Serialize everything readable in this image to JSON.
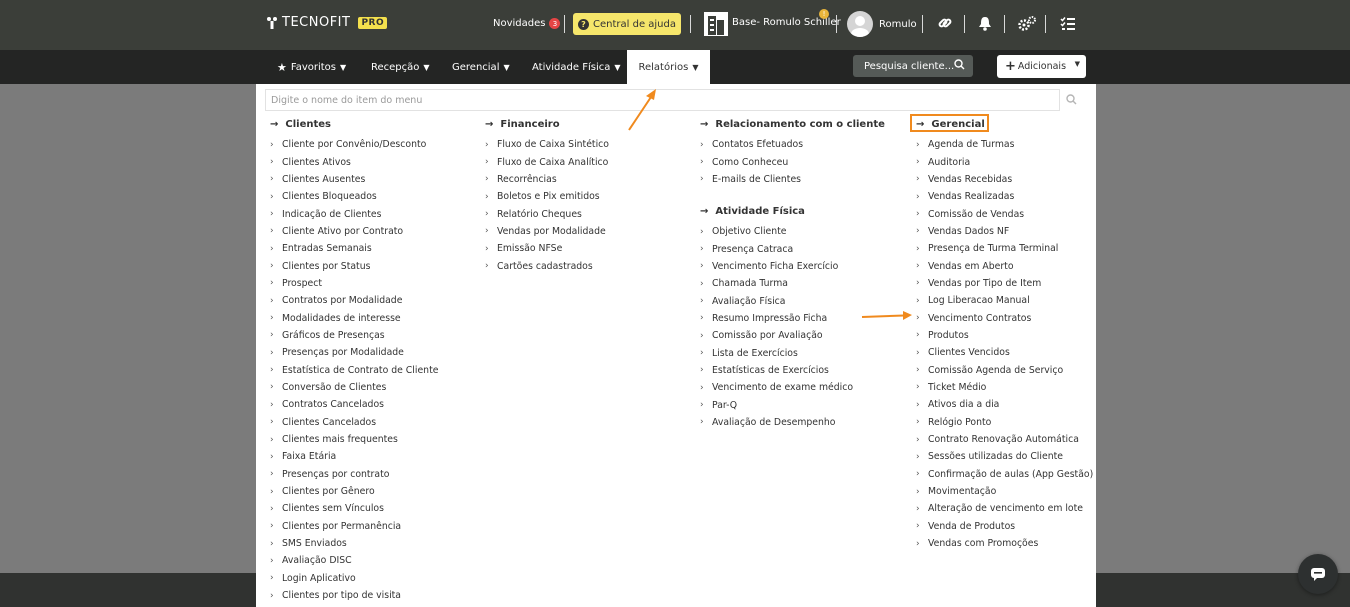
{
  "topbar": {
    "brand": "TECNOFIT",
    "brand_badge": "PRO",
    "novidades_label": "Novidades",
    "novidades_count": "3",
    "help_label": "Central de ajuda",
    "base_label": "Base- Romulo Schiller",
    "base_badge": "!",
    "user_name": "Romulo"
  },
  "navbar": {
    "items": [
      {
        "label": "Favoritos"
      },
      {
        "label": "Recepção"
      },
      {
        "label": "Gerencial"
      },
      {
        "label": "Atividade Física"
      },
      {
        "label": "Relatórios"
      }
    ],
    "search_placeholder": "Pesquisa cliente...",
    "add_label": "Adicionais"
  },
  "menu": {
    "search_placeholder": "Digite o nome do item do menu",
    "clientes": {
      "title": "Clientes",
      "items": [
        "Cliente por Convênio/Desconto",
        "Clientes Ativos",
        "Clientes Ausentes",
        "Clientes Bloqueados",
        "Indicação de Clientes",
        "Cliente Ativo por Contrato",
        "Entradas Semanais",
        "Clientes por Status",
        "Prospect",
        "Contratos por Modalidade",
        "Modalidades de interesse",
        "Gráficos de Presenças",
        "Presenças por Modalidade",
        "Estatística de Contrato de Cliente",
        "Conversão de Clientes",
        "Contratos Cancelados",
        "Clientes Cancelados",
        "Clientes mais frequentes",
        "Faixa Etária",
        "Presenças por contrato",
        "Clientes por Gênero",
        "Clientes sem Vínculos",
        "Clientes por Permanência",
        "SMS Enviados",
        "Avaliação DISC",
        "Login Aplicativo",
        "Clientes por tipo de visita"
      ]
    },
    "financeiro": {
      "title": "Financeiro",
      "items": [
        "Fluxo de Caixa Sintético",
        "Fluxo de Caixa Analítico",
        "Recorrências",
        "Boletos e Pix emitidos",
        "Relatório Cheques",
        "Vendas por Modalidade",
        "Emissão NFSe",
        "Cartões cadastrados"
      ]
    },
    "relacionamento": {
      "title": "Relacionamento com o cliente",
      "items": [
        "Contatos Efetuados",
        "Como Conheceu",
        "E-mails de Clientes"
      ]
    },
    "atividade": {
      "title": "Atividade Física",
      "items": [
        "Objetivo Cliente",
        "Presença Catraca",
        "Vencimento Ficha Exercício",
        "Chamada Turma",
        "Avaliação Física",
        "Resumo Impressão Ficha",
        "Comissão por Avaliação",
        "Lista de Exercícios",
        "Estatísticas de Exercícios",
        "Vencimento de exame médico",
        "Par-Q",
        "Avaliação de Desempenho"
      ]
    },
    "gerencial": {
      "title": "Gerencial",
      "items": [
        "Agenda de Turmas",
        "Auditoria",
        "Vendas Recebidas",
        "Vendas Realizadas",
        "Comissão de Vendas",
        "Vendas Dados NF",
        "Presença de Turma Terminal",
        "Vendas em Aberto",
        "Vendas por Tipo de Item",
        "Log Liberacao Manual",
        "Vencimento Contratos",
        "Produtos",
        "Clientes Vencidos",
        "Comissão Agenda de Serviço",
        "Ticket Médio",
        "Ativos dia a dia",
        "Relógio Ponto",
        "Contrato Renovação Automática",
        "Sessões utilizadas do Cliente",
        "Confirmação de aulas (App Gestão)",
        "Movimentação",
        "Alteração de vencimento em lote",
        "Venda de Produtos",
        "Vendas com Promoções"
      ]
    }
  },
  "colors": {
    "accent": "#f08a1e",
    "help_button": "#f6e66b",
    "topbar": "#3b3e39",
    "navbar": "#242524"
  }
}
